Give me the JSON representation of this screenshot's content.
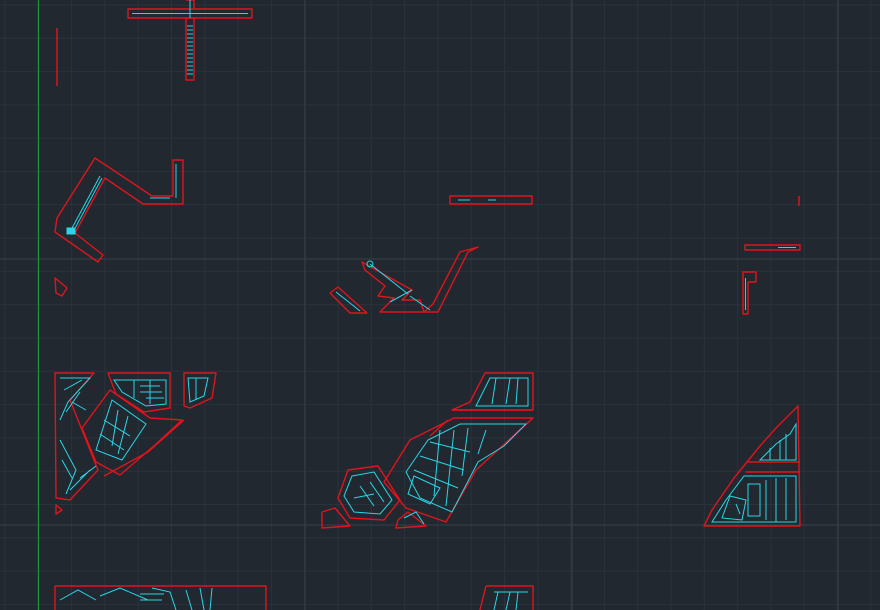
{
  "canvas": {
    "background": "#212830",
    "grid_minor_color": "#2a323c",
    "grid_major_color": "#36404b",
    "y_axis_color": "#1e9a3a",
    "outline_color": "#e0141c",
    "detail_color": "#29d6e6"
  }
}
